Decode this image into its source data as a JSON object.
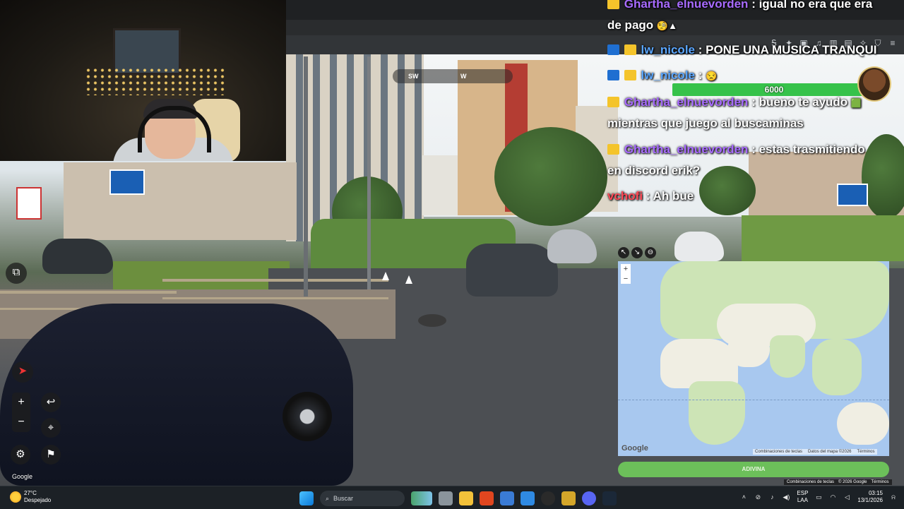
{
  "chat": {
    "messages": [
      {
        "user": "Ghartha_elnuevorden",
        "text": ": igual no era que era"
      },
      {
        "user": "",
        "text": "de pago"
      },
      {
        "user": "lw_nicole",
        "text": ": PONE UNA MUSICA TRANQUI"
      },
      {
        "user": "lw_nicole",
        "text": ":"
      },
      {
        "user": "Ghartha_elnuevorden",
        "text": ": bueno te ayudo"
      },
      {
        "user": "",
        "text": "mientras que juego al buscaminas"
      },
      {
        "user": "Ghartha_elnuevorden",
        "text": ": estas trasmitiendo"
      },
      {
        "user": "",
        "text": "en discord erik?"
      },
      {
        "user": "vchofi",
        "text": ": Ah bue"
      }
    ],
    "hp_value": "6000"
  },
  "compass": {
    "sw": "SW",
    "w": "W"
  },
  "streetview": {
    "google_label": "Google"
  },
  "map": {
    "google_label": "Google",
    "attr_shortcuts": "Combinaciones de teclas",
    "attr_data": "Datos del mapa ©2026",
    "attr_terms": "Términos",
    "guess_label": "ADIVINA"
  },
  "bottom_attr": {
    "shortcuts": "Combinaciones de teclas",
    "copyright": "© 2026 Google",
    "terms": "Términos"
  },
  "taskbar": {
    "weather_temp": "27°C",
    "weather_desc": "Despejado",
    "search_label": "Buscar",
    "lang_top": "ESP",
    "lang_bottom": "LAA",
    "time": "03:15",
    "date": "13/1/2026"
  }
}
